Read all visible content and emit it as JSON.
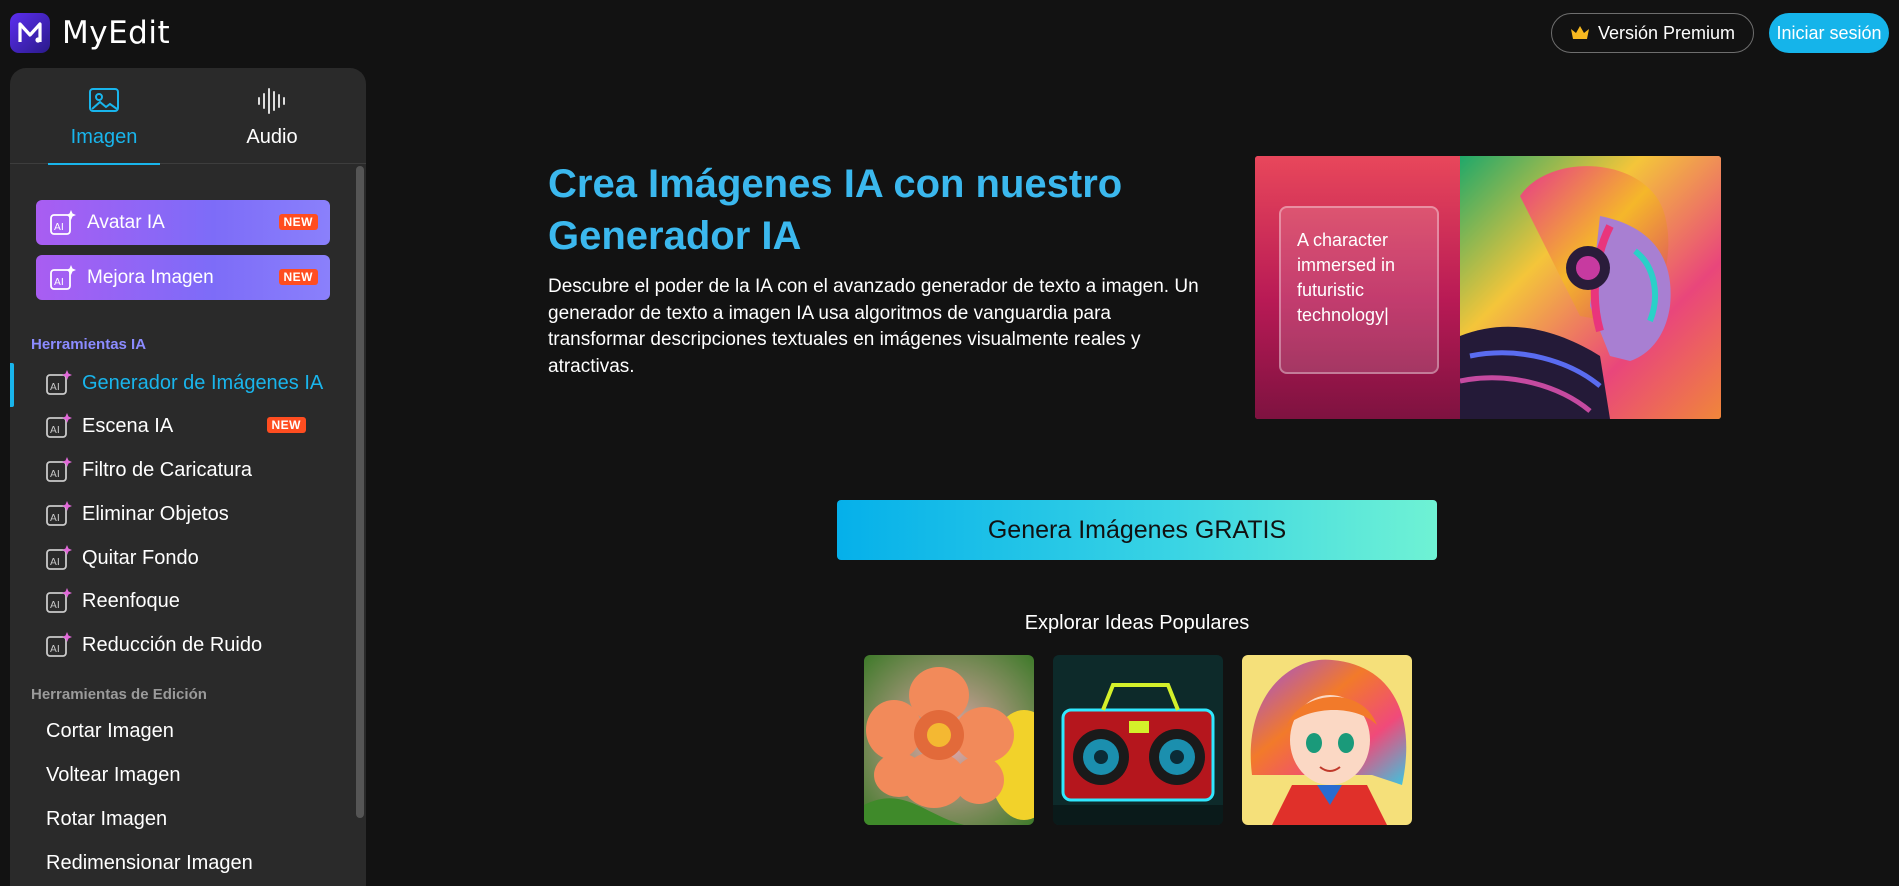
{
  "header": {
    "brand": "MyEdit",
    "premium_label": "Versión Premium",
    "login_label": "Iniciar sesión"
  },
  "sidebar": {
    "tabs": [
      {
        "label": "Imagen",
        "icon": "image-icon",
        "active": true
      },
      {
        "label": "Audio",
        "icon": "waveform-icon",
        "active": false
      }
    ],
    "featured": [
      {
        "label": "Avatar IA",
        "badge": "NEW"
      },
      {
        "label": "Mejora Imagen",
        "badge": "NEW"
      }
    ],
    "ai_section_title": "Herramientas IA",
    "ai_tools": [
      {
        "label": "Generador de Imágenes IA",
        "active": true,
        "badge": ""
      },
      {
        "label": "Escena IA",
        "badge": "NEW"
      },
      {
        "label": "Filtro de Caricatura",
        "badge": ""
      },
      {
        "label": "Eliminar Objetos",
        "badge": ""
      },
      {
        "label": "Quitar Fondo",
        "badge": ""
      },
      {
        "label": "Reenfoque",
        "badge": ""
      },
      {
        "label": "Reducción de Ruido",
        "badge": ""
      }
    ],
    "edit_section_title": "Herramientas de Edición",
    "edit_tools": [
      {
        "label": "Cortar Imagen"
      },
      {
        "label": "Voltear Imagen"
      },
      {
        "label": "Rotar Imagen"
      },
      {
        "label": "Redimensionar Imagen"
      }
    ]
  },
  "main": {
    "title_line1": "Crea Imágenes IA con nuestro",
    "title_line2": "Generador IA",
    "description": "Descubre el poder de la IA con el avanzado generador de texto a imagen. Un generador de texto a imagen IA usa algoritmos de vanguardia para transformar descripciones textuales en imágenes visualmente reales y atractivas.",
    "hero_prompt": "A character immersed in futuristic technology|",
    "cta_label": "Genera Imágenes GRATIS",
    "explore_title": "Explorar Ideas Populares",
    "ideas": [
      {
        "name": "flower-idea"
      },
      {
        "name": "boombox-idea"
      },
      {
        "name": "anime-girl-idea"
      }
    ]
  },
  "colors": {
    "accent": "#19b5ec",
    "section_ai": "#8b8bff",
    "section_edit": "#9a9a9a",
    "badge": "#ff4d20"
  }
}
